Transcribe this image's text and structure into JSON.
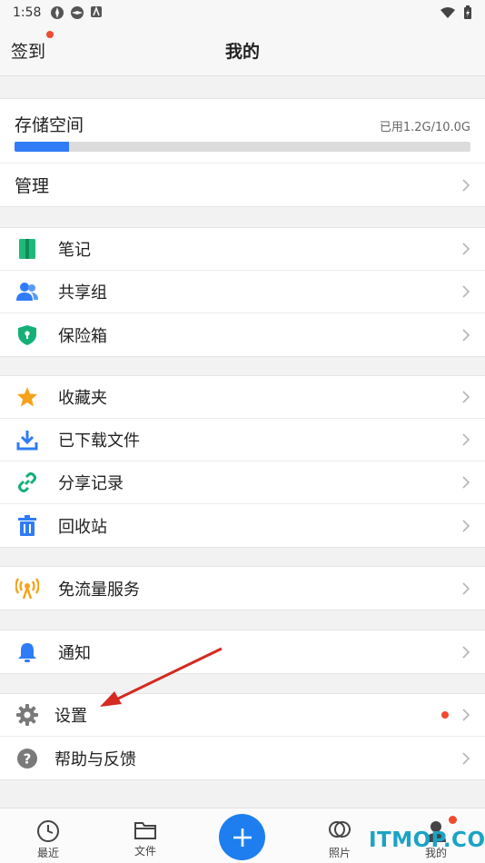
{
  "status_bar": {
    "time": "1:58"
  },
  "header": {
    "signin_label": "签到",
    "title": "我的"
  },
  "storage": {
    "title": "存储空间",
    "used_text": "已用1.2G/10.0G",
    "used_fraction": 0.12,
    "manage_label": "管理"
  },
  "group1": [
    {
      "label": "笔记",
      "icon": "notebook-icon"
    },
    {
      "label": "共享组",
      "icon": "users-icon"
    },
    {
      "label": "保险箱",
      "icon": "shield-lock-icon"
    }
  ],
  "group2": [
    {
      "label": "收藏夹",
      "icon": "star-icon"
    },
    {
      "label": "已下载文件",
      "icon": "download-icon"
    },
    {
      "label": "分享记录",
      "icon": "link-icon"
    },
    {
      "label": "回收站",
      "icon": "trash-icon"
    }
  ],
  "group3": [
    {
      "label": "免流量服务",
      "icon": "antenna-icon"
    }
  ],
  "group4": [
    {
      "label": "通知",
      "icon": "bell-icon"
    }
  ],
  "group5": [
    {
      "label": "设置",
      "icon": "gear-icon"
    },
    {
      "label": "帮助与反馈",
      "icon": "help-icon"
    }
  ],
  "tabs": [
    {
      "label": "最近",
      "icon": "clock-icon"
    },
    {
      "label": "文件",
      "icon": "folder-icon"
    },
    {
      "label": "照片",
      "icon": "photo-icon"
    },
    {
      "label": "我的",
      "icon": "user-icon"
    }
  ],
  "watermark": "ITMOP.COM",
  "colors": {
    "accent": "#1e7ef0",
    "badge": "#f04a2f",
    "progress": "#2f7cf6",
    "annotation_arrow": "#d42a22"
  }
}
